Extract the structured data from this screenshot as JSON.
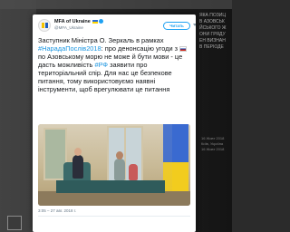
{
  "background": {
    "side_text": [
      "ЯКА ПОЗИЦ",
      "В АЗОВСЬК",
      "ЙСЬКОГО Ж",
      "ОНИ ГРЯДУ",
      "ЕН ВИЗНАН",
      "В ПЕРІОДЕ"
    ],
    "side_lower": [
      "16 Жовт 2018",
      "Київ, Україна",
      "16 Жовт 2018"
    ]
  },
  "tweet": {
    "account_name": "MFA of Ukraine",
    "handle": "@MFA_Ukraine",
    "follow_label": "Читать",
    "text_1": "Заступник Міністра О. Зеркаль в рамках",
    "hashtag_1": "#НарадаПослів2018",
    "text_2": ": про денонсацію угоди з ",
    "text_3": " по Азовському морю не може й бути мови - це дасть можливість ",
    "hashtag_2": "#РФ",
    "text_4": " заявити про територіальний спір. Для нас це безпекове питання, тому використовуємо наявні інструменти, щоб врегулювати це питання",
    "timestamp": "3:05 – 27 авг. 2018 г."
  },
  "colors": {
    "link": "#1b95e0",
    "follow_accent": "#1da1f2",
    "ua_blue": "#2a6fd6",
    "ua_yellow": "#ffd500"
  },
  "icons": {
    "flag": "ukraine-flag-icon",
    "verified": "verified-badge-icon",
    "caret": "chevron-down-icon",
    "inline_flag": "russia-flag-icon"
  }
}
